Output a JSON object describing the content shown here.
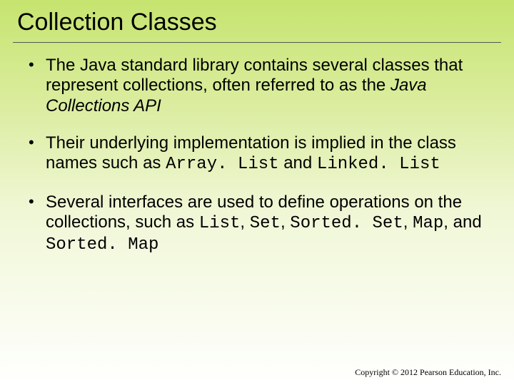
{
  "title": "Collection Classes",
  "bullets": [
    {
      "pre": "The Java standard library contains several classes that represent collections, often referred to as the ",
      "emph": "Java Collections API",
      "emph_class": "italic",
      "post": ""
    },
    {
      "pre": "Their underlying implementation is implied in the class names such as ",
      "list": [
        {
          "t": "Array. List",
          "c": "mono"
        },
        {
          "t": " and ",
          "c": ""
        },
        {
          "t": "Linked. List",
          "c": "mono"
        }
      ]
    },
    {
      "pre": "Several interfaces are used to define operations on the collections, such as ",
      "list": [
        {
          "t": "List",
          "c": "mono"
        },
        {
          "t": ", ",
          "c": ""
        },
        {
          "t": "Set",
          "c": "mono"
        },
        {
          "t": ", ",
          "c": ""
        },
        {
          "t": "Sorted. Set",
          "c": "mono"
        },
        {
          "t": ", ",
          "c": ""
        },
        {
          "t": "Map",
          "c": "mono"
        },
        {
          "t": ", and ",
          "c": ""
        },
        {
          "t": "Sorted. Map",
          "c": "mono"
        }
      ]
    }
  ],
  "footer": "Copyright © 2012 Pearson Education, Inc."
}
